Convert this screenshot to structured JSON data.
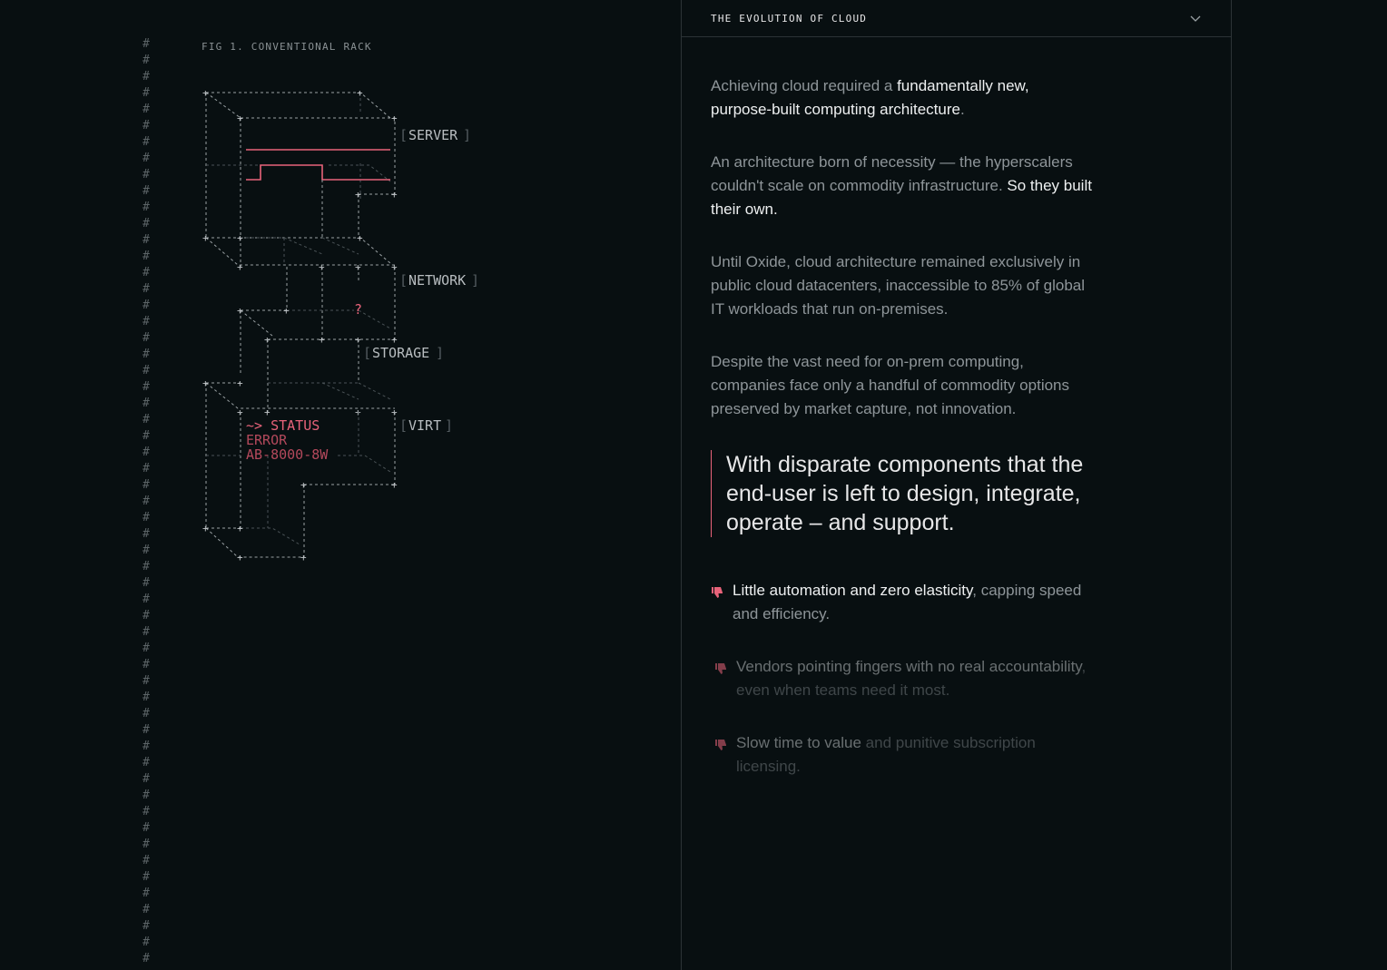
{
  "gutter": {
    "glyph": "#",
    "rows": 57
  },
  "figure": {
    "label": "FIG 1. CONVENTIONAL RACK",
    "labels": {
      "server": "SERVER",
      "network": "NETWORK",
      "storage": "STORAGE",
      "virt": "VIRT",
      "question": "?",
      "status": "~> STATUS",
      "error": "ERROR",
      "code": "AB-8000-8W"
    },
    "accent_color": "#e8637a"
  },
  "panel": {
    "title": "THE EVOLUTION OF CLOUD",
    "toggle_icon": "chevron-down-icon",
    "paragraphs": [
      {
        "plain": "Achieving cloud required a ",
        "highlight": "fundamentally new, purpose-built computing architecture",
        "tail": "."
      },
      {
        "plain": "An architecture born of necessity — the hyperscalers couldn't scale on commodity infrastructure. ",
        "highlight": "So they built their own.",
        "tail": ""
      },
      {
        "plain": "Until Oxide, cloud architecture remained exclusively in public cloud datacenters, inaccessible to 85% of global IT workloads that run on-premises.",
        "highlight": "",
        "tail": ""
      },
      {
        "plain": "Despite the vast need for on-prem computing, companies face only a handful of commodity options preserved by market capture, not innovation.",
        "highlight": "",
        "tail": ""
      }
    ],
    "quote": "With disparate components that the end-user is left to design, integrate, operate – and support.",
    "items": [
      {
        "icon": "thumbs-down-icon",
        "strong": "Little automation and zero elasticity",
        "rest": ", capping speed and efficiency."
      },
      {
        "icon": "thumbs-down-icon",
        "strong": "Vendors pointing fingers with no real accountability",
        "rest": ", even when teams need it most."
      },
      {
        "icon": "thumbs-down-icon",
        "strong": "Slow time to value",
        "rest": " and punitive subscription licensing."
      }
    ]
  }
}
